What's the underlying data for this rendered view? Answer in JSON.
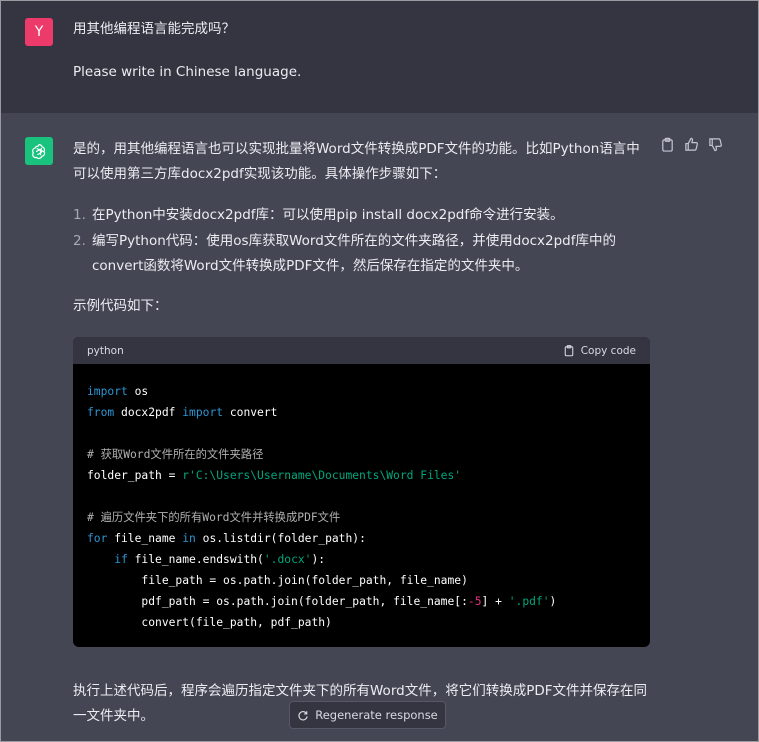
{
  "user": {
    "avatar_letter": "Y",
    "line1": "用其他编程语言能完成吗？",
    "line2": "Please write in Chinese language."
  },
  "assistant": {
    "intro": "是的，用其他编程语言也可以实现批量将Word文件转换成PDF文件的功能。比如Python语言中可以使用第三方库docx2pdf实现该功能。具体操作步骤如下：",
    "steps": [
      {
        "num": "1.",
        "text": "在Python中安装docx2pdf库：可以使用pip install docx2pdf命令进行安装。"
      },
      {
        "num": "2.",
        "text": "编写Python代码：使用os库获取Word文件所在的文件夹路径，并使用docx2pdf库中的convert函数将Word文件转换成PDF文件，然后保存在指定的文件夹中。"
      }
    ],
    "example_label": "示例代码如下：",
    "code_lang": "python",
    "copy_label": "Copy code",
    "code": {
      "l1_kw": "import",
      "l1_rest": " os",
      "l2_kw1": "from",
      "l2_mid": " docx2pdf ",
      "l2_kw2": "import",
      "l2_rest": " convert",
      "c1": "# 获取Word文件所在的文件夹路径",
      "l4_a": "folder_path = ",
      "l4_str": "r'C:\\Users\\Username\\Documents\\Word Files'",
      "c2": "# 遍历文件夹下的所有Word文件并转换成PDF文件",
      "l6_kw1": "for",
      "l6_mid": " file_name ",
      "l6_kw2": "in",
      "l6_rest": " os.listdir(folder_path):",
      "l7_kw": "if",
      "l7_mid": " file_name.endswith(",
      "l7_str": "'.docx'",
      "l7_end": "):",
      "l8": "file_path = os.path.join(folder_path, file_name)",
      "l9_a": "pdf_path = os.path.join(folder_path, file_name[:",
      "l9_num": "-5",
      "l9_b": "] + ",
      "l9_str": "'.pdf'",
      "l9_end": ")",
      "l10": "convert(file_path, pdf_path)"
    },
    "outro": "执行上述代码后，程序会遍历指定文件夹下的所有Word文件，将它们转换成PDF文件并保存在同一文件夹中。"
  },
  "regenerate_label": "Regenerate response",
  "icons": [
    "clipboard-icon",
    "thumbs-up-icon",
    "thumbs-down-icon",
    "openai-logo-icon",
    "refresh-icon"
  ]
}
